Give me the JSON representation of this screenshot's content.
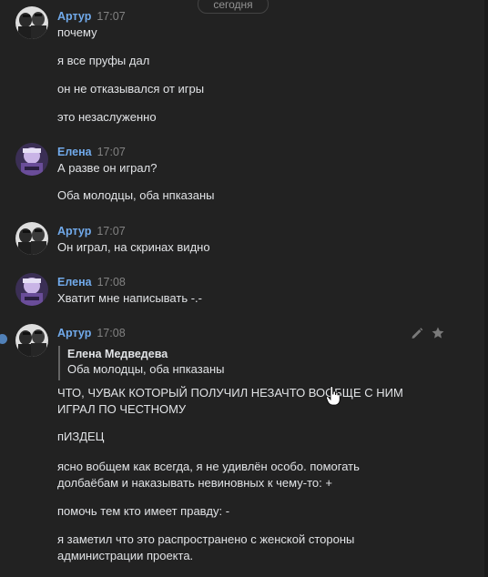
{
  "date_divider": "сегодня",
  "messages": [
    {
      "author": "Артур",
      "time": "17:07",
      "lines": [
        "почему",
        "я все пруфы дал",
        "он не отказывался от игры",
        "это незаслуженно"
      ]
    },
    {
      "author": "Елена",
      "time": "17:07",
      "lines": [
        "А разве он играл?",
        "Оба молодцы, оба нпказаны"
      ]
    },
    {
      "author": "Артур",
      "time": "17:07",
      "lines": [
        "Он играл, на скринах видно"
      ]
    },
    {
      "author": "Елена",
      "time": "17:08",
      "lines": [
        "Хватит мне написывать -.-"
      ]
    },
    {
      "author": "Артур",
      "time": "17:08",
      "reply": {
        "author": "Елена Медведева",
        "text": "Оба молодцы, оба нпказаны"
      },
      "lines": [
        "ЧТО, ЧУВАК КОТОРЫЙ ПОЛУЧИЛ НЕЗАЧТО ВООБЩЕ С НИМ ИГРАЛ ПО ЧЕСТНОМУ",
        "пИЗДЕЦ",
        "ясно вобщем как всегда, я не удивлён особо. помогать долбаёбам и наказывать невиновных к чему-то: +",
        "помочь тем кто имеет правду: -",
        "я заметил что это распространено с женской стороны администрации проекта."
      ]
    }
  ],
  "icons": {
    "edit": "pencil-icon",
    "favorite": "star-icon"
  },
  "colors": {
    "background": "#222222",
    "author": "#71aaeb",
    "time": "#828282",
    "text": "#e1e3e6"
  }
}
